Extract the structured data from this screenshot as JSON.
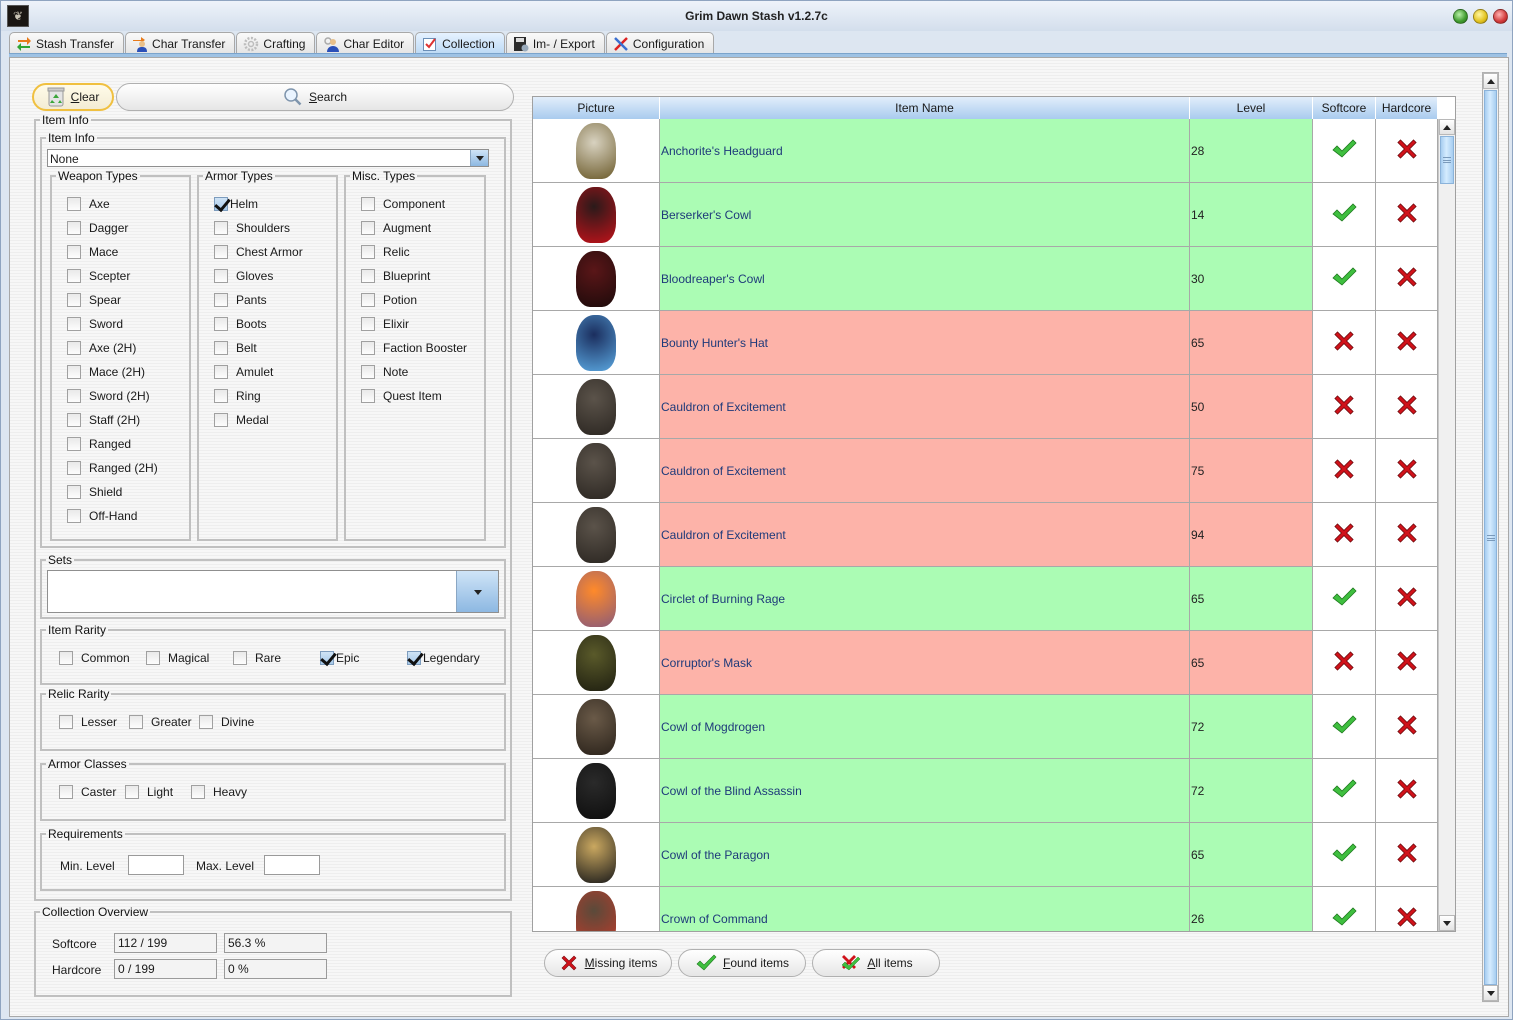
{
  "window": {
    "title": "Grim Dawn Stash v1.2.7c",
    "app_icon": "grim-dawn-logo-icon",
    "controls": [
      "maximize",
      "minimize",
      "close"
    ]
  },
  "tabs": [
    {
      "label": "Stash Transfer",
      "icon": "transfer-arrows-icon",
      "active": false
    },
    {
      "label": "Char Transfer",
      "icon": "char-transfer-icon",
      "active": false
    },
    {
      "label": "Crafting",
      "icon": "gear-icon",
      "active": false
    },
    {
      "label": "Char Editor",
      "icon": "char-editor-icon",
      "active": false
    },
    {
      "label": "Collection",
      "icon": "checklist-icon",
      "active": true
    },
    {
      "label": "Im- / Export",
      "icon": "floppy-disk-icon",
      "active": false
    },
    {
      "label": "Configuration",
      "icon": "tools-icon",
      "active": false
    }
  ],
  "toolbar": {
    "clear_label": "Clear",
    "clear_mnemonic": "C",
    "clear_rest": "lear",
    "search_label": "Search",
    "search_mnemonic": "S",
    "search_rest": "earch"
  },
  "filters": {
    "item_info_outer_title": "Item Info",
    "item_info_inner_title": "Item Info",
    "item_info_selected": "None",
    "weapon_types": {
      "title": "Weapon Types",
      "items": [
        {
          "label": "Axe",
          "checked": false
        },
        {
          "label": "Dagger",
          "checked": false
        },
        {
          "label": "Mace",
          "checked": false
        },
        {
          "label": "Scepter",
          "checked": false
        },
        {
          "label": "Spear",
          "checked": false
        },
        {
          "label": "Sword",
          "checked": false
        },
        {
          "label": "Axe (2H)",
          "checked": false
        },
        {
          "label": "Mace (2H)",
          "checked": false
        },
        {
          "label": "Sword (2H)",
          "checked": false
        },
        {
          "label": "Staff (2H)",
          "checked": false
        },
        {
          "label": "Ranged",
          "checked": false
        },
        {
          "label": "Ranged (2H)",
          "checked": false
        },
        {
          "label": "Shield",
          "checked": false
        },
        {
          "label": "Off-Hand",
          "checked": false
        }
      ]
    },
    "armor_types": {
      "title": "Armor Types",
      "items": [
        {
          "label": "Helm",
          "checked": true
        },
        {
          "label": "Shoulders",
          "checked": false
        },
        {
          "label": "Chest Armor",
          "checked": false
        },
        {
          "label": "Gloves",
          "checked": false
        },
        {
          "label": "Pants",
          "checked": false
        },
        {
          "label": "Boots",
          "checked": false
        },
        {
          "label": "Belt",
          "checked": false
        },
        {
          "label": "Amulet",
          "checked": false
        },
        {
          "label": "Ring",
          "checked": false
        },
        {
          "label": "Medal",
          "checked": false
        }
      ]
    },
    "misc_types": {
      "title": "Misc. Types",
      "items": [
        {
          "label": "Component",
          "checked": false
        },
        {
          "label": "Augment",
          "checked": false
        },
        {
          "label": "Relic",
          "checked": false
        },
        {
          "label": "Blueprint",
          "checked": false
        },
        {
          "label": "Potion",
          "checked": false
        },
        {
          "label": "Elixir",
          "checked": false
        },
        {
          "label": "Faction Booster",
          "checked": false
        },
        {
          "label": "Note",
          "checked": false
        },
        {
          "label": "Quest Item",
          "checked": false
        }
      ]
    },
    "sets": {
      "title": "Sets",
      "selected": ""
    },
    "item_rarity": {
      "title": "Item Rarity",
      "items": [
        {
          "label": "Common",
          "checked": false
        },
        {
          "label": "Magical",
          "checked": false
        },
        {
          "label": "Rare",
          "checked": false
        },
        {
          "label": "Epic",
          "checked": true
        },
        {
          "label": "Legendary",
          "checked": true
        }
      ]
    },
    "relic_rarity": {
      "title": "Relic Rarity",
      "items": [
        {
          "label": "Lesser",
          "checked": false
        },
        {
          "label": "Greater",
          "checked": false
        },
        {
          "label": "Divine",
          "checked": false
        }
      ]
    },
    "armor_classes": {
      "title": "Armor Classes",
      "items": [
        {
          "label": "Caster",
          "checked": false
        },
        {
          "label": "Light",
          "checked": false
        },
        {
          "label": "Heavy",
          "checked": false
        }
      ]
    },
    "requirements": {
      "title": "Requirements",
      "min_label": "Min. Level",
      "min_value": "",
      "max_label": "Max. Level",
      "max_value": ""
    }
  },
  "overview": {
    "title": "Collection Overview",
    "softcore_label": "Softcore",
    "softcore_count": "112 / 199",
    "softcore_percent": "56.3 %",
    "hardcore_label": "Hardcore",
    "hardcore_count": "0 / 199",
    "hardcore_percent": "0 %"
  },
  "table": {
    "columns": [
      "Picture",
      "Item Name",
      "Level",
      "Softcore",
      "Hardcore"
    ],
    "rows": [
      {
        "picture": "anchorite-headguard-image",
        "name": "Anchorite's Headguard",
        "level": "28",
        "softcore": true,
        "hardcore": false
      },
      {
        "picture": "berserker-cowl-image",
        "name": "Berserker's Cowl",
        "level": "14",
        "softcore": true,
        "hardcore": false
      },
      {
        "picture": "bloodreaper-cowl-image",
        "name": "Bloodreaper's Cowl",
        "level": "30",
        "softcore": true,
        "hardcore": false
      },
      {
        "picture": "bounty-hunter-hat-image",
        "name": "Bounty Hunter's Hat",
        "level": "65",
        "softcore": false,
        "hardcore": false
      },
      {
        "picture": "cauldron-of-excitement-image",
        "name": "Cauldron of Excitement",
        "level": "50",
        "softcore": false,
        "hardcore": false
      },
      {
        "picture": "cauldron-of-excitement-image",
        "name": "Cauldron of Excitement",
        "level": "75",
        "softcore": false,
        "hardcore": false
      },
      {
        "picture": "cauldron-of-excitement-image",
        "name": "Cauldron of Excitement",
        "level": "94",
        "softcore": false,
        "hardcore": false
      },
      {
        "picture": "circlet-of-burning-rage-image",
        "name": "Circlet of Burning Rage",
        "level": "65",
        "softcore": true,
        "hardcore": false
      },
      {
        "picture": "corruptor-mask-image",
        "name": "Corruptor's Mask",
        "level": "65",
        "softcore": false,
        "hardcore": false
      },
      {
        "picture": "cowl-of-mogdrogen-image",
        "name": "Cowl of Mogdrogen",
        "level": "72",
        "softcore": true,
        "hardcore": false
      },
      {
        "picture": "cowl-of-the-blind-assassin-image",
        "name": "Cowl of the Blind Assassin",
        "level": "72",
        "softcore": true,
        "hardcore": false
      },
      {
        "picture": "cowl-of-the-paragon-image",
        "name": "Cowl of the Paragon",
        "level": "65",
        "softcore": true,
        "hardcore": false
      },
      {
        "picture": "crown-of-command-image",
        "name": "Crown of Command",
        "level": "26",
        "softcore": true,
        "hardcore": false
      }
    ]
  },
  "bottom_buttons": {
    "missing_mnemonic": "M",
    "missing_rest": "issing items",
    "found_mnemonic": "F",
    "found_rest": "ound items",
    "all_mnemonic": "A",
    "all_rest": "ll items"
  },
  "colors": {
    "found_row": "#abfcb4",
    "missing_row": "#fdb3a9",
    "item_name_text": "#1e3a7a",
    "check_green": "#3fbf3f",
    "cross_red": "#d0121a"
  }
}
